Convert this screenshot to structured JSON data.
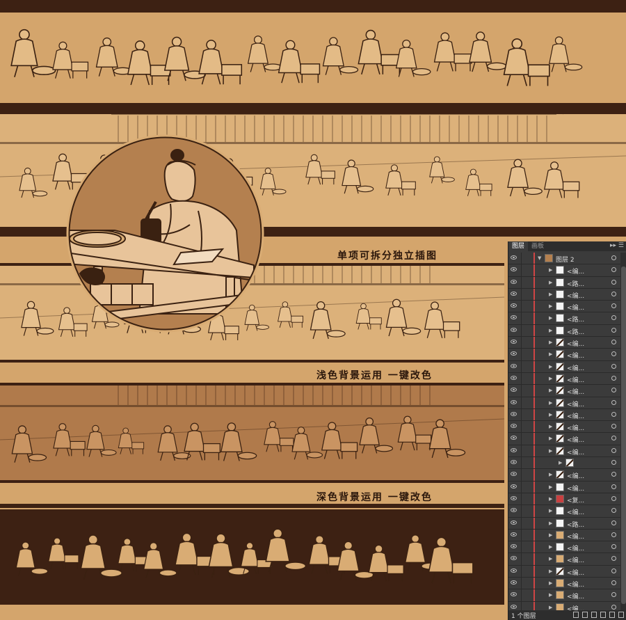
{
  "captions": {
    "split": "单项可拆分独立插图",
    "light": "浅色背景运用  一键改色",
    "dark": "深色背景运用  一键改色"
  },
  "colors": {
    "background": "#d4a56c",
    "dark_band": "#3d2113",
    "light_panel": "#d9ac74",
    "sepia_panel": "#b07a4b",
    "medallion": "#b4804f",
    "line": "#3a2111"
  },
  "layers_panel": {
    "tabs": [
      "图层",
      "画板"
    ],
    "menu": "▸▸ ☰",
    "group_name": "图层 2",
    "rows": [
      {
        "indent": 1,
        "name": "<编...",
        "thumb": "white"
      },
      {
        "indent": 1,
        "name": "<路...",
        "thumb": "white"
      },
      {
        "indent": 1,
        "name": "<编...",
        "thumb": "white"
      },
      {
        "indent": 1,
        "name": "<编...",
        "thumb": "white"
      },
      {
        "indent": 1,
        "name": "<路...",
        "thumb": "white"
      },
      {
        "indent": 1,
        "name": "<路...",
        "thumb": "white"
      },
      {
        "indent": 1,
        "name": "<编...",
        "thumb": "figure"
      },
      {
        "indent": 1,
        "name": "<编...",
        "thumb": "figure"
      },
      {
        "indent": 1,
        "name": "<编...",
        "thumb": "figure"
      },
      {
        "indent": 1,
        "name": "<编...",
        "thumb": "figure"
      },
      {
        "indent": 1,
        "name": "<编...",
        "thumb": "figure"
      },
      {
        "indent": 1,
        "name": "<编...",
        "thumb": "figure"
      },
      {
        "indent": 1,
        "name": "<编...",
        "thumb": "figure"
      },
      {
        "indent": 1,
        "name": "<编...",
        "thumb": "figure"
      },
      {
        "indent": 1,
        "name": "<编...",
        "thumb": "figure"
      },
      {
        "indent": 1,
        "name": "<编...",
        "thumb": "figure"
      },
      {
        "indent": 2,
        "name": "",
        "thumb": "figure"
      },
      {
        "indent": 1,
        "name": "<编...",
        "thumb": "figure"
      },
      {
        "indent": 1,
        "name": "<编...",
        "thumb": "white"
      },
      {
        "indent": 1,
        "name": "<复...",
        "thumb": "red"
      },
      {
        "indent": 1,
        "name": "<编...",
        "thumb": "white"
      },
      {
        "indent": 1,
        "name": "<路...",
        "thumb": "white"
      },
      {
        "indent": 1,
        "name": "<编...",
        "thumb": "tan"
      },
      {
        "indent": 1,
        "name": "<编...",
        "thumb": "white"
      },
      {
        "indent": 1,
        "name": "<编...",
        "thumb": "tan"
      },
      {
        "indent": 1,
        "name": "<编...",
        "thumb": "figure"
      },
      {
        "indent": 1,
        "name": "<编...",
        "thumb": "tan"
      },
      {
        "indent": 1,
        "name": "<编...",
        "thumb": "tan"
      },
      {
        "indent": 1,
        "name": "<编...",
        "thumb": "tan"
      },
      {
        "indent": 1,
        "name": "<编...",
        "thumb": "tan"
      }
    ],
    "footer_count": "1 个图层"
  }
}
